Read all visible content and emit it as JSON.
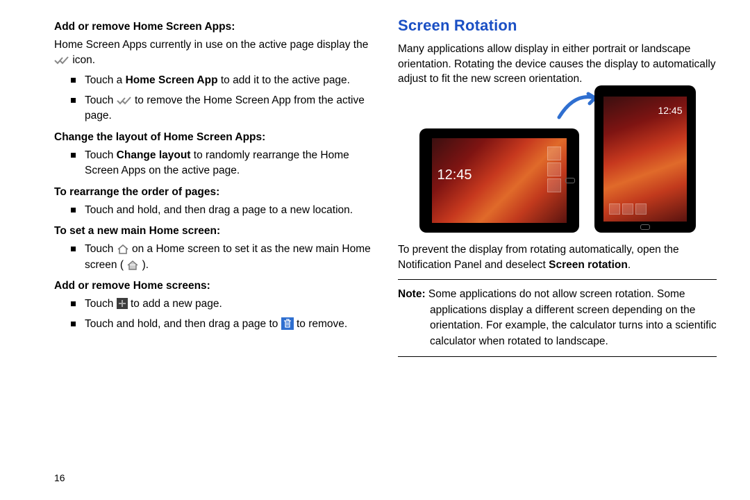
{
  "page_number": "16",
  "left": {
    "h1": "Add or remove Home Screen Apps:",
    "p1a": "Home Screen Apps currently in use on the active page display the ",
    "p1b": " icon.",
    "b1a_pre": "Touch a ",
    "b1a_bold": "Home Screen App",
    "b1a_post": " to add it to the active page.",
    "b1b_pre": "Touch ",
    "b1b_post": " to remove the Home Screen App from the active page.",
    "h2": "Change the layout of Home Screen Apps:",
    "b2_pre": "Touch ",
    "b2_bold": "Change layout",
    "b2_post": " to randomly rearrange the Home Screen Apps on the active page.",
    "h3": "To rearrange the order of pages:",
    "b3": "Touch and hold, and then drag a page to a new location.",
    "h4": "To set a new main Home screen:",
    "b4_pre": "Touch ",
    "b4_mid": " on a Home screen to set it as the new main Home screen (",
    "b4_post": ").",
    "h5": "Add or remove Home screens:",
    "b5a_pre": "Touch ",
    "b5a_post": " to add a new page.",
    "b5b_pre": "Touch and hold, and then drag a page to ",
    "b5b_post": " to remove."
  },
  "right": {
    "title": "Screen Rotation",
    "p1": "Many applications allow display in either portrait or landscape orientation. Rotating the device causes the display to automatically adjust to fit the new screen orientation.",
    "clock_land": "12:45",
    "clock_port": "12:45",
    "p2_pre": "To prevent the display from rotating automatically, open the Notification Panel and deselect ",
    "p2_bold": "Screen rotation",
    "p2_post": ".",
    "note_label": "Note:",
    "note_text": " Some applications do not allow screen rotation. Some applications display a different screen depending on the orientation. For example, the calculator turns into a scientific calculator when rotated to landscape."
  }
}
